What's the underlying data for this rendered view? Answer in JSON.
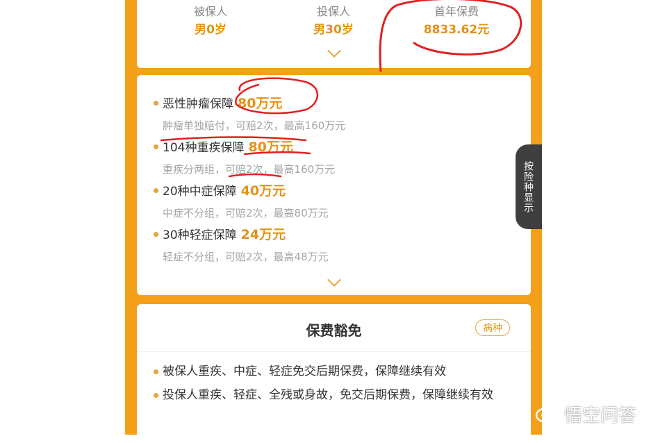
{
  "summary": {
    "insured": {
      "label": "被保人",
      "value": "男0岁"
    },
    "policyholder": {
      "label": "投保人",
      "value": "男30岁"
    },
    "first_year_premium": {
      "label": "首年保费",
      "value": "8833.62元"
    }
  },
  "coverage": [
    {
      "title": "恶性肿瘤保障",
      "amount": "80万元",
      "detail": "肿瘤单独赔付，可赔2次，最高160万元"
    },
    {
      "title": "104种重疾保障",
      "amount": "80万元",
      "detail": "重疾分两组，可赔2次，最高160万元"
    },
    {
      "title": "20种中症保障",
      "amount": "40万元",
      "detail": "中症不分组，可赔2次，最高80万元"
    },
    {
      "title": "30种轻症保障",
      "amount": "24万元",
      "detail": "轻症不分组，可赔2次，最高48万元"
    }
  ],
  "side_tab": {
    "label": "按险种显示"
  },
  "waiver": {
    "title": "保费豁免",
    "badge": "病种",
    "items": [
      "被保人重疾、中症、轻症免交后期保费，保障继续有效",
      "投保人重疾、轻症、全残或身故，免交后期保费，保障继续有效"
    ]
  },
  "watermark": {
    "text": "悟空问答"
  },
  "colors": {
    "accent": "#f5a01a",
    "amount": "#e39318",
    "annotation": "#e02020"
  }
}
